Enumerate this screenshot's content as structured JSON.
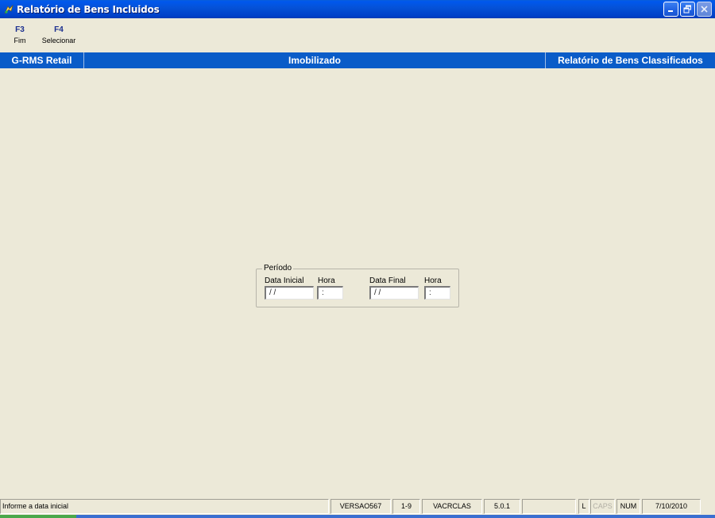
{
  "window": {
    "title": "Relatório de Bens Incluidos",
    "icon": "app-icon",
    "buttons": [
      "minimize-icon",
      "restore-icon",
      "close-icon"
    ]
  },
  "toolbar": {
    "items": [
      {
        "key": "F3",
        "label": "Fim"
      },
      {
        "key": "F4",
        "label": "Selecionar"
      }
    ]
  },
  "header": {
    "left": "G-RMS Retail",
    "center": "Imobilizado",
    "right": "Relatório de Bens Classificados",
    "color": "#0a5cc8"
  },
  "periodo": {
    "title": "Período",
    "data_inicial": {
      "label": "Data Inicial",
      "value": " / /"
    },
    "hora_inicial": {
      "label": "Hora",
      "value": ":"
    },
    "data_final": {
      "label": "Data Final",
      "value": " / /"
    },
    "hora_final": {
      "label": "Hora",
      "value": ":"
    }
  },
  "statusbar": {
    "message": "Informe a data inicial",
    "version": "VERSAO567",
    "range": "1-9",
    "program": "VACRCLAS",
    "release": "5.0.1",
    "blank": "",
    "l": "L",
    "caps": "CAPS",
    "num": "NUM",
    "date": "7/10/2010"
  }
}
